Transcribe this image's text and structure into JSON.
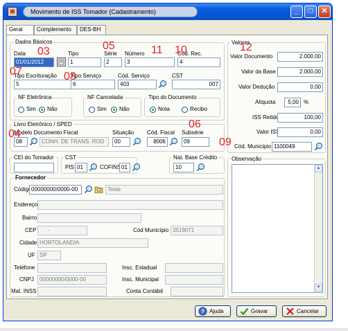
{
  "window": {
    "title": "Movimento de ISS Tomador (Cadastramento)"
  },
  "tabs": [
    "Geral",
    "Complemento",
    "DES-BH"
  ],
  "annotations": [
    "03",
    "05",
    "11",
    "10",
    "12",
    "07",
    "08",
    "06",
    "04",
    "09"
  ],
  "dados_basicos": {
    "title": "Dados Básicos",
    "data_label": "Data",
    "data_value": "01/01/2012",
    "tipo_label": "Tipo",
    "tipo_value": "1",
    "serie_label": "Série",
    "serie_value": "2",
    "numero_label": "Número",
    "numero_value": "3",
    "cod_rec_label": "Cód. Rec.",
    "cod_rec_value": "4",
    "tipo_escrituracao_label": "Tipo Escrituração",
    "tipo_escrituracao_value": "5",
    "tipo_servico_label": "Tipo Serviço",
    "tipo_servico_value": "6",
    "cod_servico_label": "Cód. Serviço",
    "cod_servico_value": "403",
    "cst_label": "CST",
    "cst_value": "007",
    "nf_eletronica": {
      "title": "NF Eletrônica",
      "options": [
        "Sim",
        "Não"
      ],
      "selected": "Não"
    },
    "nf_cancelada": {
      "title": "NF Cancelada",
      "options": [
        "Sim",
        "Não"
      ],
      "selected": "Não"
    },
    "tipo_documento": {
      "title": "Tipo do Documento",
      "options": [
        "Nota",
        "Recibo"
      ],
      "selected": "Nota"
    }
  },
  "livro": {
    "title": "Livro Eletrônico / SPED",
    "modelo_label": "Modelo Documento Fiscal",
    "modelo_code": "08",
    "modelo_desc": "CONH. DE TRANS. ROD",
    "situacao_label": "Situação",
    "situacao_value": "00",
    "cod_fiscal_label": "Cód. Fiscal",
    "cod_fiscal_value": "8006",
    "subserie_label": "Subsérie",
    "subserie_value": "09"
  },
  "cei_label": "CEI do Tomador",
  "cst_group": {
    "title": "CST",
    "pis_label": "PIS",
    "pis_value": "01",
    "cofins_label": "COFINS",
    "cofins_value": "01"
  },
  "nat_base": {
    "title": "Nat. Base Crédito",
    "value": "10"
  },
  "fornecedor": {
    "title": "Fornecedor",
    "codigo_label": "Código",
    "codigo_value": "00000000/0000-00",
    "nome_value": "Teste",
    "endereco_label": "Endereço",
    "bairro_label": "Bairro",
    "cep_label": "CEP",
    "cep_value": "-",
    "cod_municipio_label": "Cód Município",
    "cod_municipio_value": "3519071",
    "cidade_label": "Cidade",
    "cidade_value": "HORTOLANDIA",
    "uf_label": "UF",
    "uf_value": "SP",
    "telefone_label": "Telefone",
    "insc_estadual_label": "Insc. Estadual",
    "cnpj_label": "CNPJ",
    "cnpj_value": "00000000/0000-00",
    "insc_municipal_label": "Insc. Municipal",
    "mat_inss_label": "Mat. INSS",
    "conta_contabil_label": "Conta Contábil"
  },
  "valores": {
    "title": "Valores",
    "valor_documento_label": "Valor Documento",
    "valor_documento": "2.000,00",
    "valor_base_label": "Valor da Base",
    "valor_base": "2.000,00",
    "valor_deducao_label": "Valor Dedução",
    "valor_deducao": "0,00",
    "aliquota_label": "Alíquota",
    "aliquota": "5,00",
    "aliquota_unit": "%",
    "iss_retido_label": "ISS Retido",
    "iss_retido": "100,00",
    "valor_iss_label": "Valor ISS",
    "valor_iss": "0,00",
    "cod_municipio_label": "Cód. Municipio",
    "cod_municipio": "1100049"
  },
  "observacao_label": "Observação",
  "buttons": {
    "ajuda": "Ajuda",
    "gravar": "Gravar",
    "cancelar": "Cancelar"
  },
  "colors": {
    "annotation": "#e0242c",
    "title_bar": "#0a5ee0",
    "selected": "#316ac5"
  }
}
